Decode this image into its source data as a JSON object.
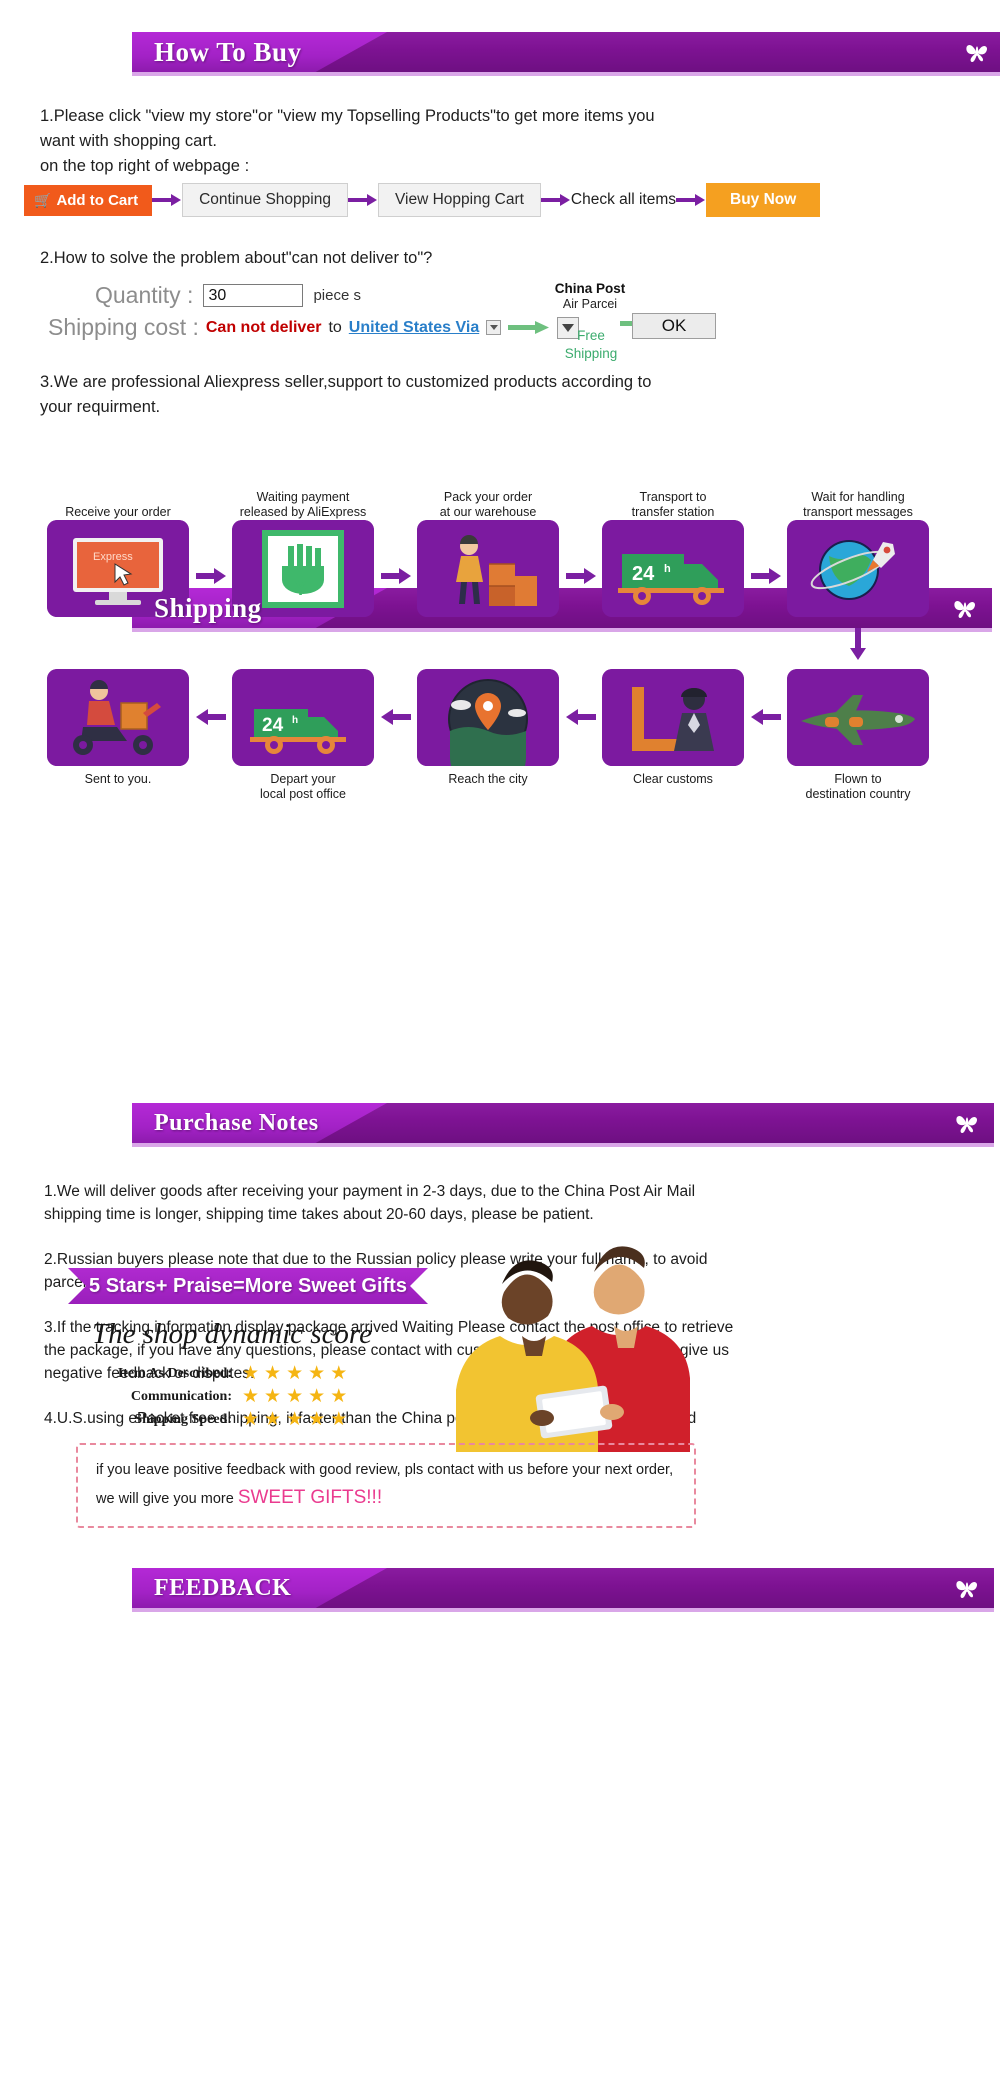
{
  "sections": {
    "how_to_buy": {
      "title": "How To Buy",
      "intro_line1": "1.Please click \"view my store\"or \"view my Topselling Products\"to get more items you",
      "intro_line2": "want with shopping cart.",
      "intro_line3": "on the top right of webpage :",
      "buttons": {
        "add_to_cart": "Add to Cart",
        "continue_shopping": "Continue Shopping",
        "view_hopping_cart": "View Hopping Cart",
        "check_all_items": "Check all items",
        "buy_now": "Buy Now"
      },
      "question2": "2.How to solve the problem about\"can not deliver to\"?",
      "quantity_label": "Quantity :",
      "quantity_value": "30",
      "piece_label": "piece s",
      "shipping_cost_label": "Shipping cost :",
      "cannot_deliver": "Can not deliver",
      "to_word": "to",
      "country_link": "United States Via",
      "china_post_line1": "China Post",
      "china_post_line2": "Air Parcei",
      "free_shipping_line1": "Free",
      "free_shipping_line2": "Shipping",
      "ok_button": "OK",
      "note3_line1": "3.We are professional Aliexpress seller,support to customized products according to",
      "note3_line2": "your requirment."
    },
    "shipping": {
      "title": "Shipping",
      "steps_row1": [
        {
          "label_line1": "Receive your order",
          "label_line2": "",
          "icon": "monitor-express-icon"
        },
        {
          "label_line1": "Waiting payment",
          "label_line2": "released by AliExpress",
          "icon": "payment-hand-yen-icon"
        },
        {
          "label_line1": "Pack your order",
          "label_line2": "at our warehouse",
          "icon": "worker-boxes-icon"
        },
        {
          "label_line1": "Transport to",
          "label_line2": "transfer station",
          "icon": "truck-24h-icon"
        },
        {
          "label_line1": "Wait for handling",
          "label_line2": "transport messages",
          "icon": "globe-rocket-icon"
        }
      ],
      "steps_row2": [
        {
          "label_line1": "Sent to you.",
          "label_line2": "",
          "icon": "scooter-courier-icon"
        },
        {
          "label_line1": "Depart your",
          "label_line2": "local post office",
          "icon": "van-24h-icon"
        },
        {
          "label_line1": "Reach the city",
          "label_line2": "",
          "icon": "map-pin-city-icon"
        },
        {
          "label_line1": "Clear customs",
          "label_line2": "",
          "icon": "customs-officer-icon"
        },
        {
          "label_line1": "Flown to",
          "label_line2": "destination country",
          "icon": "airplane-icon"
        }
      ]
    },
    "purchase_notes": {
      "title": "Purchase Notes",
      "notes": [
        "1.We will  deliver goods after receiving your payment in 2-3 days, due to the China Post Air Mail shipping time is longer, shipping time takes about 20-60 days, please be patient.",
        "2.Russian buyers please note that due to the Russian policy please write your full name, to avoid parcel lost.",
        "3.If the tracking information display package arrived Waiting Please contact the post office to retrieve the package, if you have any questions, please contact with customer service, please   do not give us negative feedback or disputes.",
        "4.U.S.using ePacket free shipping, it faster than the China post ,just need 7-15days can arrived"
      ]
    },
    "feedback": {
      "title": "FEEDBACK",
      "ribbon": "5 Stars+ Praise=More Sweet Gifts",
      "dynamic_score_title": "The shop dynamic score",
      "scores": [
        {
          "name": "Item As Described:",
          "stars": 5
        },
        {
          "name": "Communication:",
          "stars": 5
        },
        {
          "name": "Shipping Speed:",
          "stars": 5
        }
      ],
      "note_line1": "if you leave positive feedback with good review, pls contact with us before your next order,",
      "note_line2_prefix": "we will give you more ",
      "note_line2_highlight": "SWEET GIFTS!!!"
    }
  },
  "colors": {
    "banner_purple": "#7d1292",
    "banner_light_purple": "#b429d6",
    "orange_cart": "#f15a1b",
    "orange_buy": "#f5a020",
    "red": "#c00000",
    "link_blue": "#2a7fc9",
    "green": "#3bab6d",
    "star_gold": "#f5b513",
    "pink": "#ea3b8f"
  },
  "icons": {
    "banner_right": "butterfly-icon",
    "cart": "shopping-cart-icon",
    "arrow_purple": "arrow-right-purple-icon",
    "arrow_green": "arrow-right-green-icon",
    "dropdown": "chevron-down-icon",
    "star": "star-icon"
  }
}
